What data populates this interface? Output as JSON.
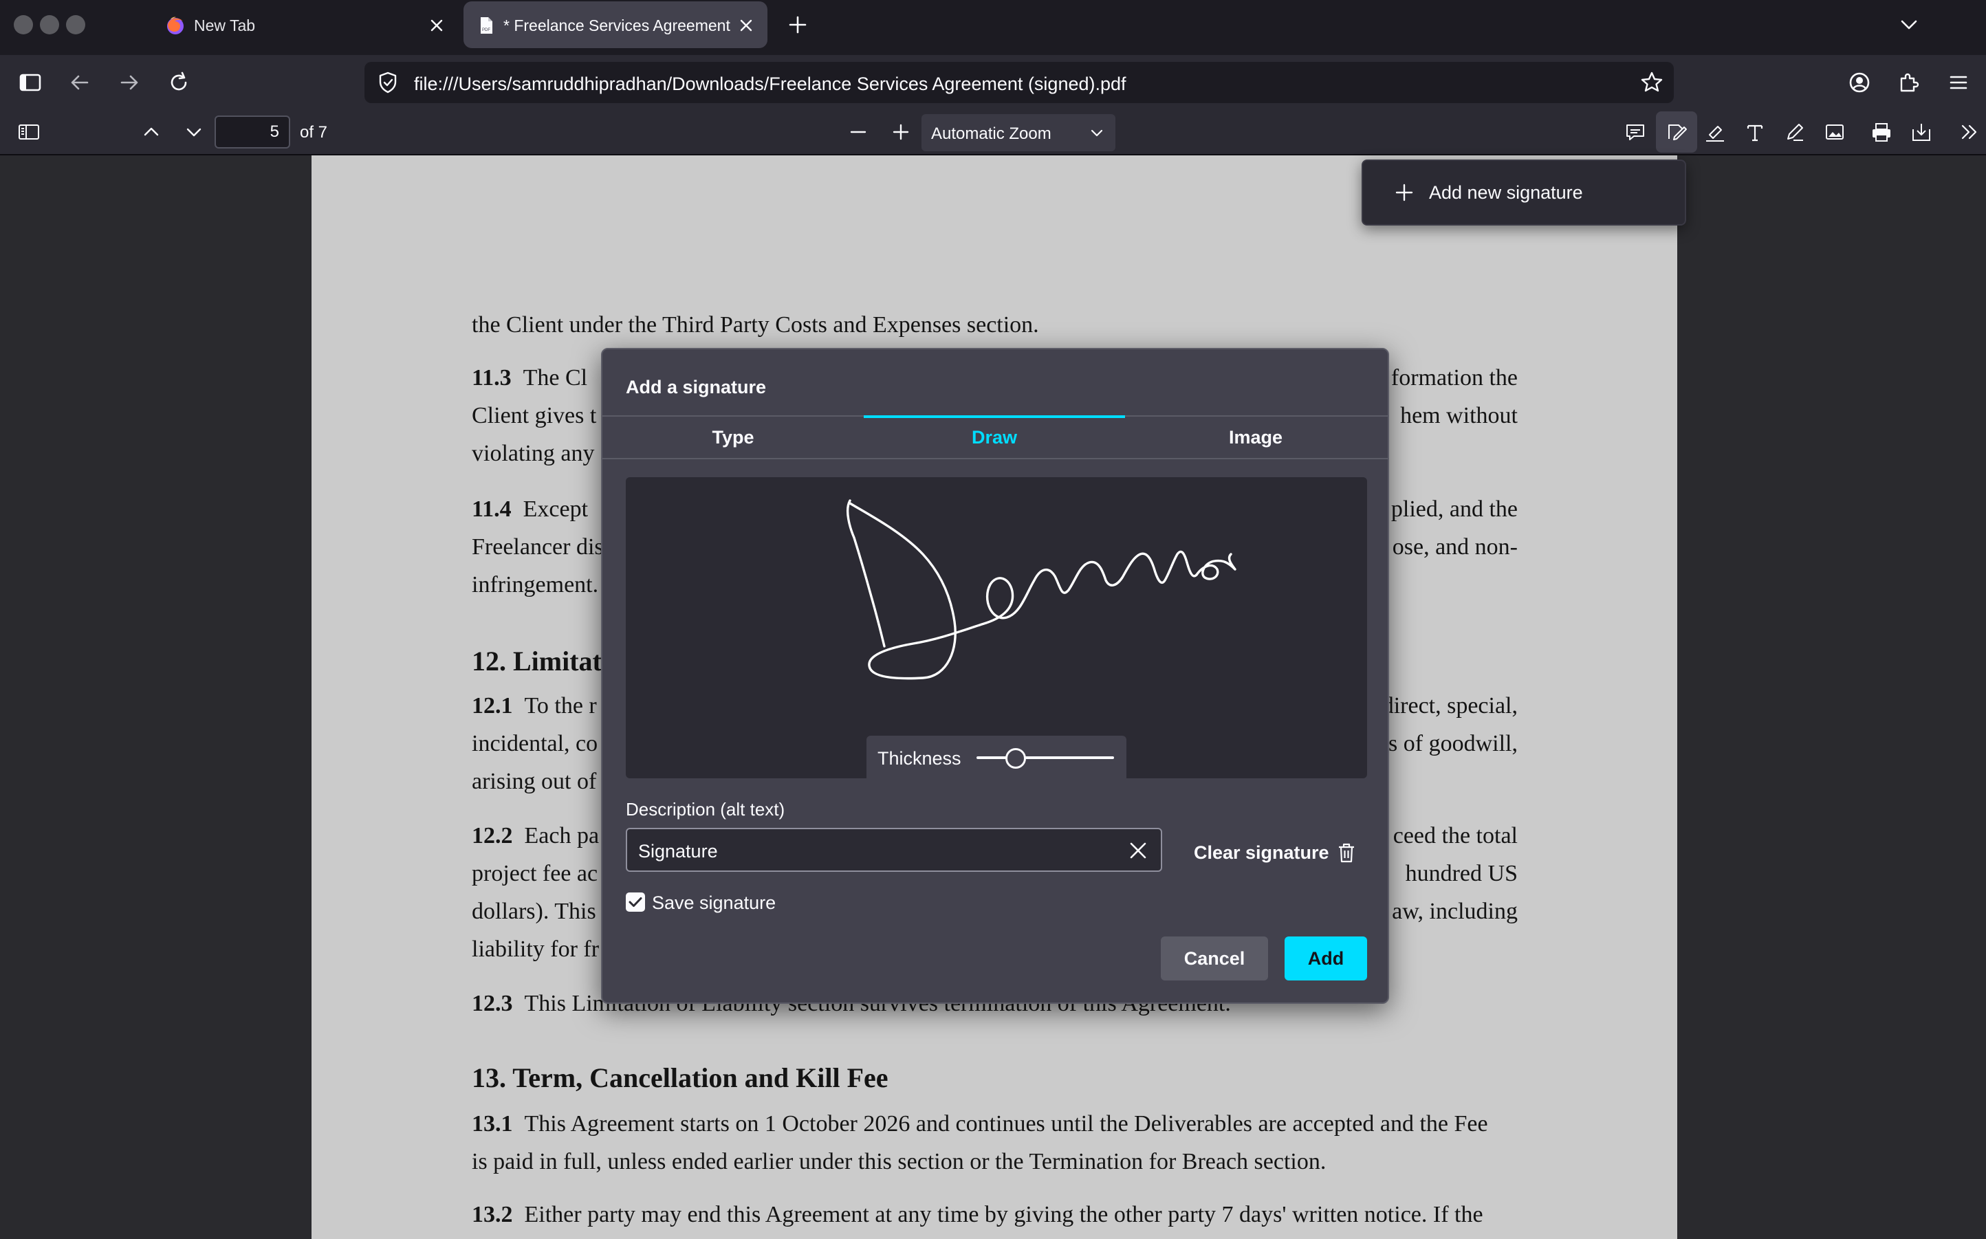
{
  "tabs": {
    "inactive_title": "New Tab",
    "active_title": "* Freelance Services Agreement (signed).pdf"
  },
  "navbar": {
    "url": "file:///Users/samruddhipradhan/Downloads/Freelance Services Agreement (signed).pdf"
  },
  "pdf_toolbar": {
    "page_number": "5",
    "page_count_label": "of 7",
    "zoom": "Automatic Zoom"
  },
  "document": {
    "line1": "the Client under the Third Party Costs and Expenses section.",
    "p11_3_num": "11.3",
    "p11_3_l1": "The Cl",
    "p11_3_l1_right": "formation the",
    "p11_3_l2": "Client gives t",
    "p11_3_l2_right": "hem without",
    "p11_3_l3": "violating any",
    "p11_4_num": "11.4",
    "p11_4_l1": "Except",
    "p11_4_l1_right": "plied, and the",
    "p11_4_l2": "Freelancer dis",
    "p11_4_l2_right": "ose, and non-",
    "p11_4_l3": "infringement.",
    "h12": "12. Limitati",
    "p12_1_num": "12.1",
    "p12_1_l1": "To the r",
    "p12_1_l1_right": "direct, special,",
    "p12_1_l2": "incidental, co",
    "p12_1_l2_right": "s of goodwill,",
    "p12_1_l3": "arising out of",
    "p12_2_num": "12.2",
    "p12_2_l1": "Each pa",
    "p12_2_l1_right": "ceed the total",
    "p12_2_l2": "project fee ac",
    "p12_2_l2_right": "hundred US",
    "p12_2_l3": "dollars). This",
    "p12_2_l3_right": "aw, including",
    "p12_2_l4": "liability for fr",
    "p12_3_num": "12.3",
    "p12_3_l1": "This Limitation of Liability section survives termination of this Agreement.",
    "h13": "13. Term, Cancellation and Kill Fee",
    "p13_1_num": "13.1",
    "p13_1_l1": "This Agreement starts on 1 October 2026 and continues until the Deliverables are accepted and the Fee",
    "p13_1_l2": "is paid in full, unless ended earlier under this section or the Termination for Breach section.",
    "p13_2_num": "13.2",
    "p13_2_l1": "Either party may end this Agreement at any time by giving the other party 7 days' written notice. If the"
  },
  "signature_menu": {
    "add_new": "Add new signature"
  },
  "dialog": {
    "title": "Add a signature",
    "tab_type": "Type",
    "tab_draw": "Draw",
    "tab_image": "Image",
    "thickness_label": "Thickness",
    "description_label": "Description (alt text)",
    "description_value": "Signature",
    "clear_signature": "Clear signature",
    "save_signature": "Save signature",
    "save_signature_checked": true,
    "cancel": "Cancel",
    "add": "Add"
  },
  "colors": {
    "accent": "#00ddff",
    "dialog_bg": "#42414d",
    "canvas_bg": "#2b2a33",
    "page_bg": "#cbcbcb"
  }
}
